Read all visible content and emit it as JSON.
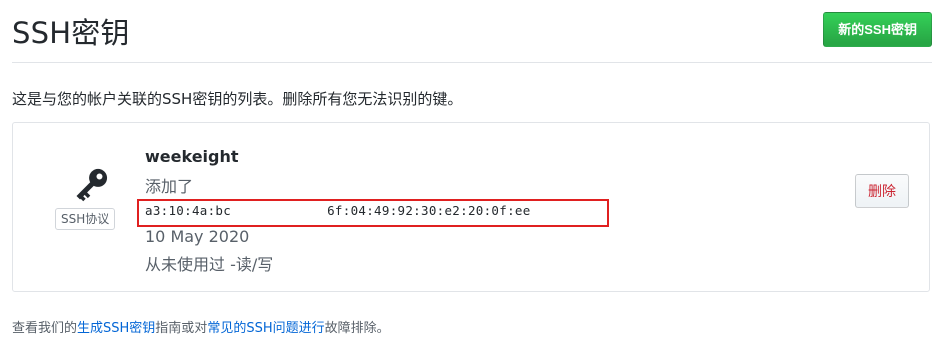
{
  "header": {
    "title": "SSH密钥",
    "new_key_label": "新的SSH密钥"
  },
  "description": "这是与您的帐户关联的SSH密钥的列表。删除所有您无法识别的键。",
  "key": {
    "title": "weekeight",
    "added_label": "添加了",
    "fingerprint_start": "a3:10:4a:bc",
    "fingerprint_end": "6f:04:49:92:30:e2:20:0f:ee",
    "added_date": "10 May 2020",
    "usage": "从未使用过 -读/写",
    "protocol_badge": "SSH协议",
    "delete_label": "删除",
    "icon": "key-icon"
  },
  "footer": {
    "text_before": "查看我们的",
    "link1": "生成SSH密钥",
    "text_middle": "指南或对",
    "link2": "常见的SSH问题进行",
    "text_after": "故障排除。"
  },
  "colors": {
    "primary_button": "#28a745",
    "danger_text": "#cb2431",
    "link": "#0366d6",
    "highlight": "#e02020"
  }
}
